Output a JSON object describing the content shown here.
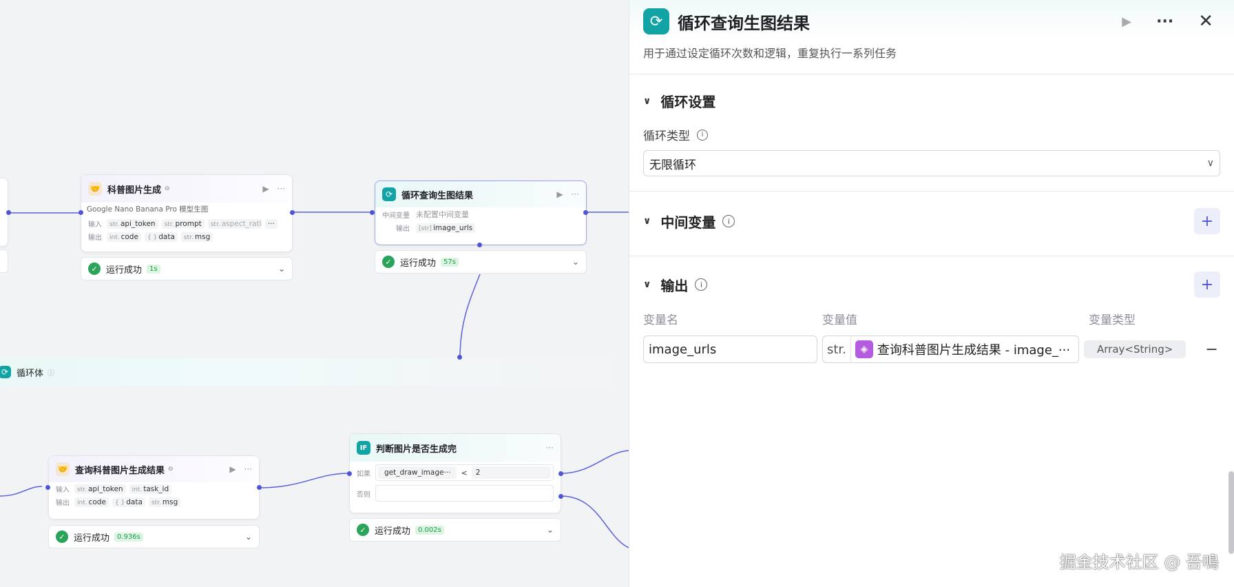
{
  "canvas": {
    "node1": {
      "title": "科普图片生成",
      "subtitle": "Google Nano Banana Pro 模型生图",
      "input_label": "输入",
      "output_label": "输出",
      "inputs": [
        {
          "type": "str.",
          "name": "api_token"
        },
        {
          "type": "str.",
          "name": "prompt"
        },
        {
          "type": "str.",
          "name": "aspect_ratio"
        }
      ],
      "outputs": [
        {
          "type": "int.",
          "name": "code"
        },
        {
          "type": "{ }",
          "name": "data"
        },
        {
          "type": "str.",
          "name": "msg"
        }
      ],
      "more": "···",
      "status": "运行成功",
      "time": "1s"
    },
    "node2": {
      "title": "循环查询生图结果",
      "mid_label": "中间变量",
      "mid_value": "未配置中间变量",
      "output_label": "输出",
      "output_type": "[str]",
      "output_name": "image_urls",
      "status": "运行成功",
      "time": "57s"
    },
    "loop_body": "循环体",
    "node3": {
      "title": "查询科普图片生成结果",
      "input_label": "输入",
      "output_label": "输出",
      "inputs": [
        {
          "type": "str.",
          "name": "api_token"
        },
        {
          "type": "int.",
          "name": "task_id"
        }
      ],
      "outputs": [
        {
          "type": "int.",
          "name": "code"
        },
        {
          "type": "{ }",
          "name": "data"
        },
        {
          "type": "str.",
          "name": "msg"
        }
      ],
      "status": "运行成功",
      "time": "0.936s"
    },
    "node4": {
      "title": "判断图片是否生成完",
      "if_label": "如果",
      "else_label": "否则",
      "cond_var": "get_draw_image···",
      "cond_op": "<",
      "cond_val": "2",
      "status": "运行成功",
      "time": "0.002s"
    }
  },
  "panel": {
    "title": "循环查询生图结果",
    "description": "用于通过设定循环次数和逻辑，重复执行一系列任务",
    "loop_settings": {
      "heading": "循环设置",
      "type_label": "循环类型",
      "type_value": "无限循环"
    },
    "mid_vars": {
      "heading": "中间变量"
    },
    "output": {
      "heading": "输出",
      "col_name": "变量名",
      "col_value": "变量值",
      "col_type": "变量类型",
      "rows": [
        {
          "name": "image_urls",
          "prefix": "str.",
          "ref": "查询科普图片生成结果 - image_···",
          "type": "Array<String>"
        }
      ]
    }
  },
  "watermark": "掘金技术社区 @ 吾鳴"
}
